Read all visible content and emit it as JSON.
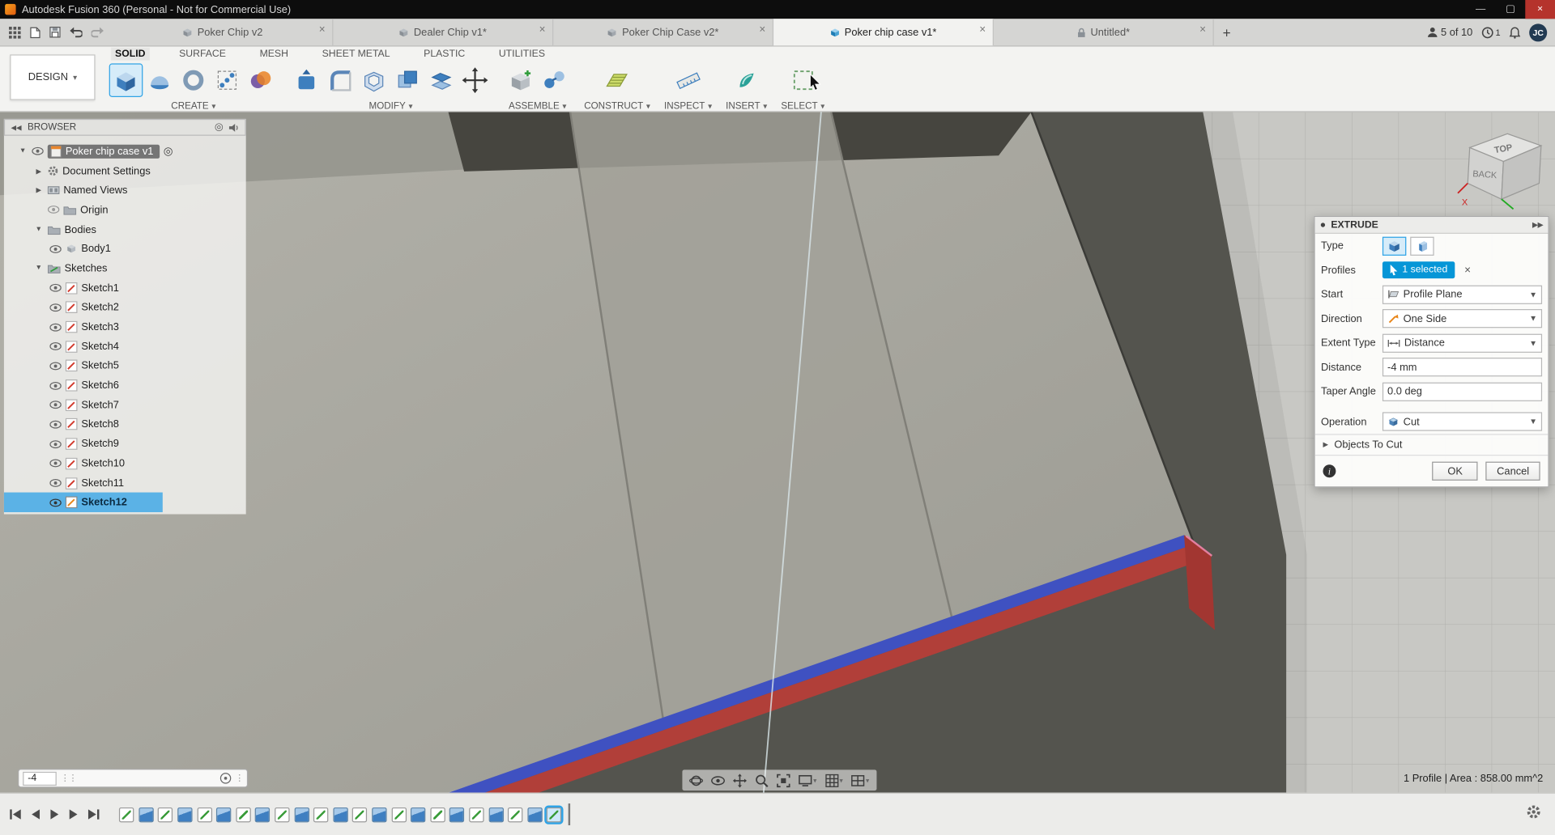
{
  "titlebar": {
    "title": "Autodesk Fusion 360 (Personal - Not for Commercial Use)"
  },
  "tabbar": {
    "tabs": [
      {
        "label": "Poker Chip v2"
      },
      {
        "label": "Dealer Chip v1*"
      },
      {
        "label": "Poker Chip Case v2*"
      },
      {
        "label": "Poker chip case v1*"
      },
      {
        "label": "Untitled*"
      }
    ],
    "share_count": "5 of 10",
    "notif_count": "1",
    "avatar_initials": "JC"
  },
  "ribbon": {
    "workspace": "DESIGN",
    "tabs": [
      {
        "label": "SOLID"
      },
      {
        "label": "SURFACE"
      },
      {
        "label": "MESH"
      },
      {
        "label": "SHEET METAL"
      },
      {
        "label": "PLASTIC"
      },
      {
        "label": "UTILITIES"
      }
    ],
    "groups": [
      {
        "label": "CREATE"
      },
      {
        "label": "MODIFY"
      },
      {
        "label": "ASSEMBLE"
      },
      {
        "label": "CONSTRUCT"
      },
      {
        "label": "INSPECT"
      },
      {
        "label": "INSERT"
      },
      {
        "label": "SELECT"
      }
    ]
  },
  "browser": {
    "title": "BROWSER",
    "root_label": "Poker chip case v1",
    "nodes": [
      {
        "label": "Document Settings"
      },
      {
        "label": "Named Views"
      },
      {
        "label": "Origin"
      },
      {
        "label": "Bodies"
      },
      {
        "label": "Body1"
      },
      {
        "label": "Sketches"
      }
    ],
    "sketches": [
      {
        "label": "Sketch1"
      },
      {
        "label": "Sketch2"
      },
      {
        "label": "Sketch3"
      },
      {
        "label": "Sketch4"
      },
      {
        "label": "Sketch5"
      },
      {
        "label": "Sketch6"
      },
      {
        "label": "Sketch7"
      },
      {
        "label": "Sketch8"
      },
      {
        "label": "Sketch9"
      },
      {
        "label": "Sketch10"
      },
      {
        "label": "Sketch11"
      },
      {
        "label": "Sketch12"
      }
    ]
  },
  "extrude_dialog": {
    "title": "EXTRUDE",
    "rows": {
      "type_label": "Type",
      "profiles_label": "Profiles",
      "profiles_value": "1 selected",
      "start_label": "Start",
      "start_value": "Profile Plane",
      "direction_label": "Direction",
      "direction_value": "One Side",
      "extent_label": "Extent Type",
      "extent_value": "Distance",
      "distance_label": "Distance",
      "distance_value": "-4 mm",
      "taper_label": "Taper Angle",
      "taper_value": "0.0 deg",
      "operation_label": "Operation",
      "operation_value": "Cut"
    },
    "objects_to_cut": "Objects To Cut",
    "ok": "OK",
    "cancel": "Cancel"
  },
  "viewcube": {
    "top": "TOP",
    "back": "BACK",
    "axis_x": "X"
  },
  "canvas": {
    "distance_input": "-4",
    "status": "1 Profile | Area : 858.00 mm^2"
  },
  "timeline": {
    "features": [
      "sketch",
      "extrude",
      "sketch",
      "extrude",
      "sketch",
      "extrude",
      "sketch",
      "extrude",
      "sketch",
      "extrude",
      "sketch",
      "extrude",
      "sketch",
      "extrude",
      "sketch",
      "extrude",
      "sketch",
      "extrude",
      "sketch",
      "extrude",
      "sketch",
      "extrude",
      "sketch-selected"
    ]
  },
  "colors": {
    "accent_blue": "#0696d7",
    "selection_profile_blue": "#3f51c1",
    "cut_preview_red": "#b13f39"
  }
}
